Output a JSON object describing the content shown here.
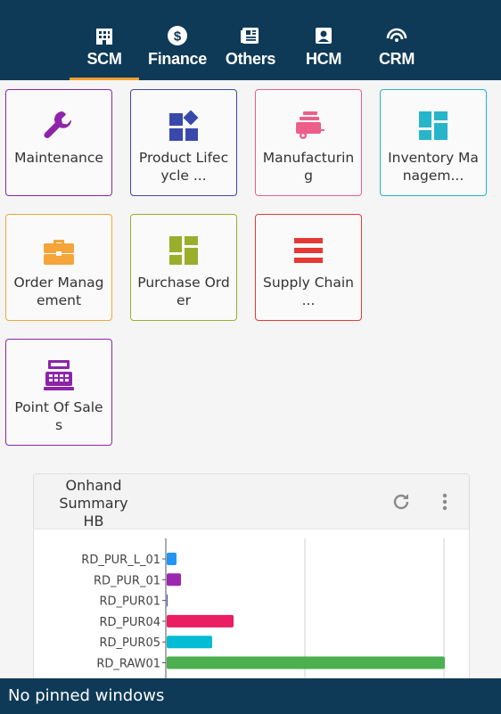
{
  "nav": {
    "tabs": [
      {
        "label": "SCM",
        "icon": "building-icon",
        "active": true
      },
      {
        "label": "Finance",
        "icon": "dollar-icon",
        "active": false
      },
      {
        "label": "Others",
        "icon": "newspaper-icon",
        "active": false
      },
      {
        "label": "HCM",
        "icon": "contact-card-icon",
        "active": false
      },
      {
        "label": "CRM",
        "icon": "signal-arc-icon",
        "active": false
      }
    ]
  },
  "tiles": [
    {
      "label": "Maintenance",
      "icon": "wrench-icon",
      "color": "#8e24aa"
    },
    {
      "label": "Product Lifecycle ...",
      "icon": "shapes-icon",
      "color": "#3949ab"
    },
    {
      "label": "Manufacturing",
      "icon": "trailer-icon",
      "color": "#ec5f8a"
    },
    {
      "label": "Inventory Managem...",
      "icon": "dashboard-icon",
      "color": "#26b5c9"
    },
    {
      "label": "Order Management",
      "icon": "briefcase-icon",
      "color": "#f5a53a"
    },
    {
      "label": "Purchase Order",
      "icon": "grid-icon",
      "color": "#9aae2c"
    },
    {
      "label": "Supply Chain ...",
      "icon": "bars-icon",
      "color": "#e53935"
    },
    {
      "label": "Point Of Sales",
      "icon": "cash-register-icon",
      "color": "#8e24aa"
    }
  ],
  "chart_panel": {
    "title": "Onhand Summary HB"
  },
  "chart_data": {
    "type": "bar",
    "orientation": "horizontal",
    "categories": [
      "RD_PUR_L_01",
      "RD_PUR_01",
      "RD_PUR01",
      "RD_PUR04",
      "RD_PUR05",
      "RD_RAW01"
    ],
    "values": [
      11,
      16,
      1,
      75,
      51,
      312
    ],
    "colors": [
      "#2196f3",
      "#9c27b0",
      "#3f51b5",
      "#e91e63",
      "#00bcd4",
      "#4caf50"
    ],
    "xlim": [
      0,
      312
    ],
    "grid": true
  },
  "footer": {
    "text": "No pinned windows"
  },
  "colors": {
    "nav_bg": "#0e3a57",
    "active_underline": "#f0a030"
  }
}
